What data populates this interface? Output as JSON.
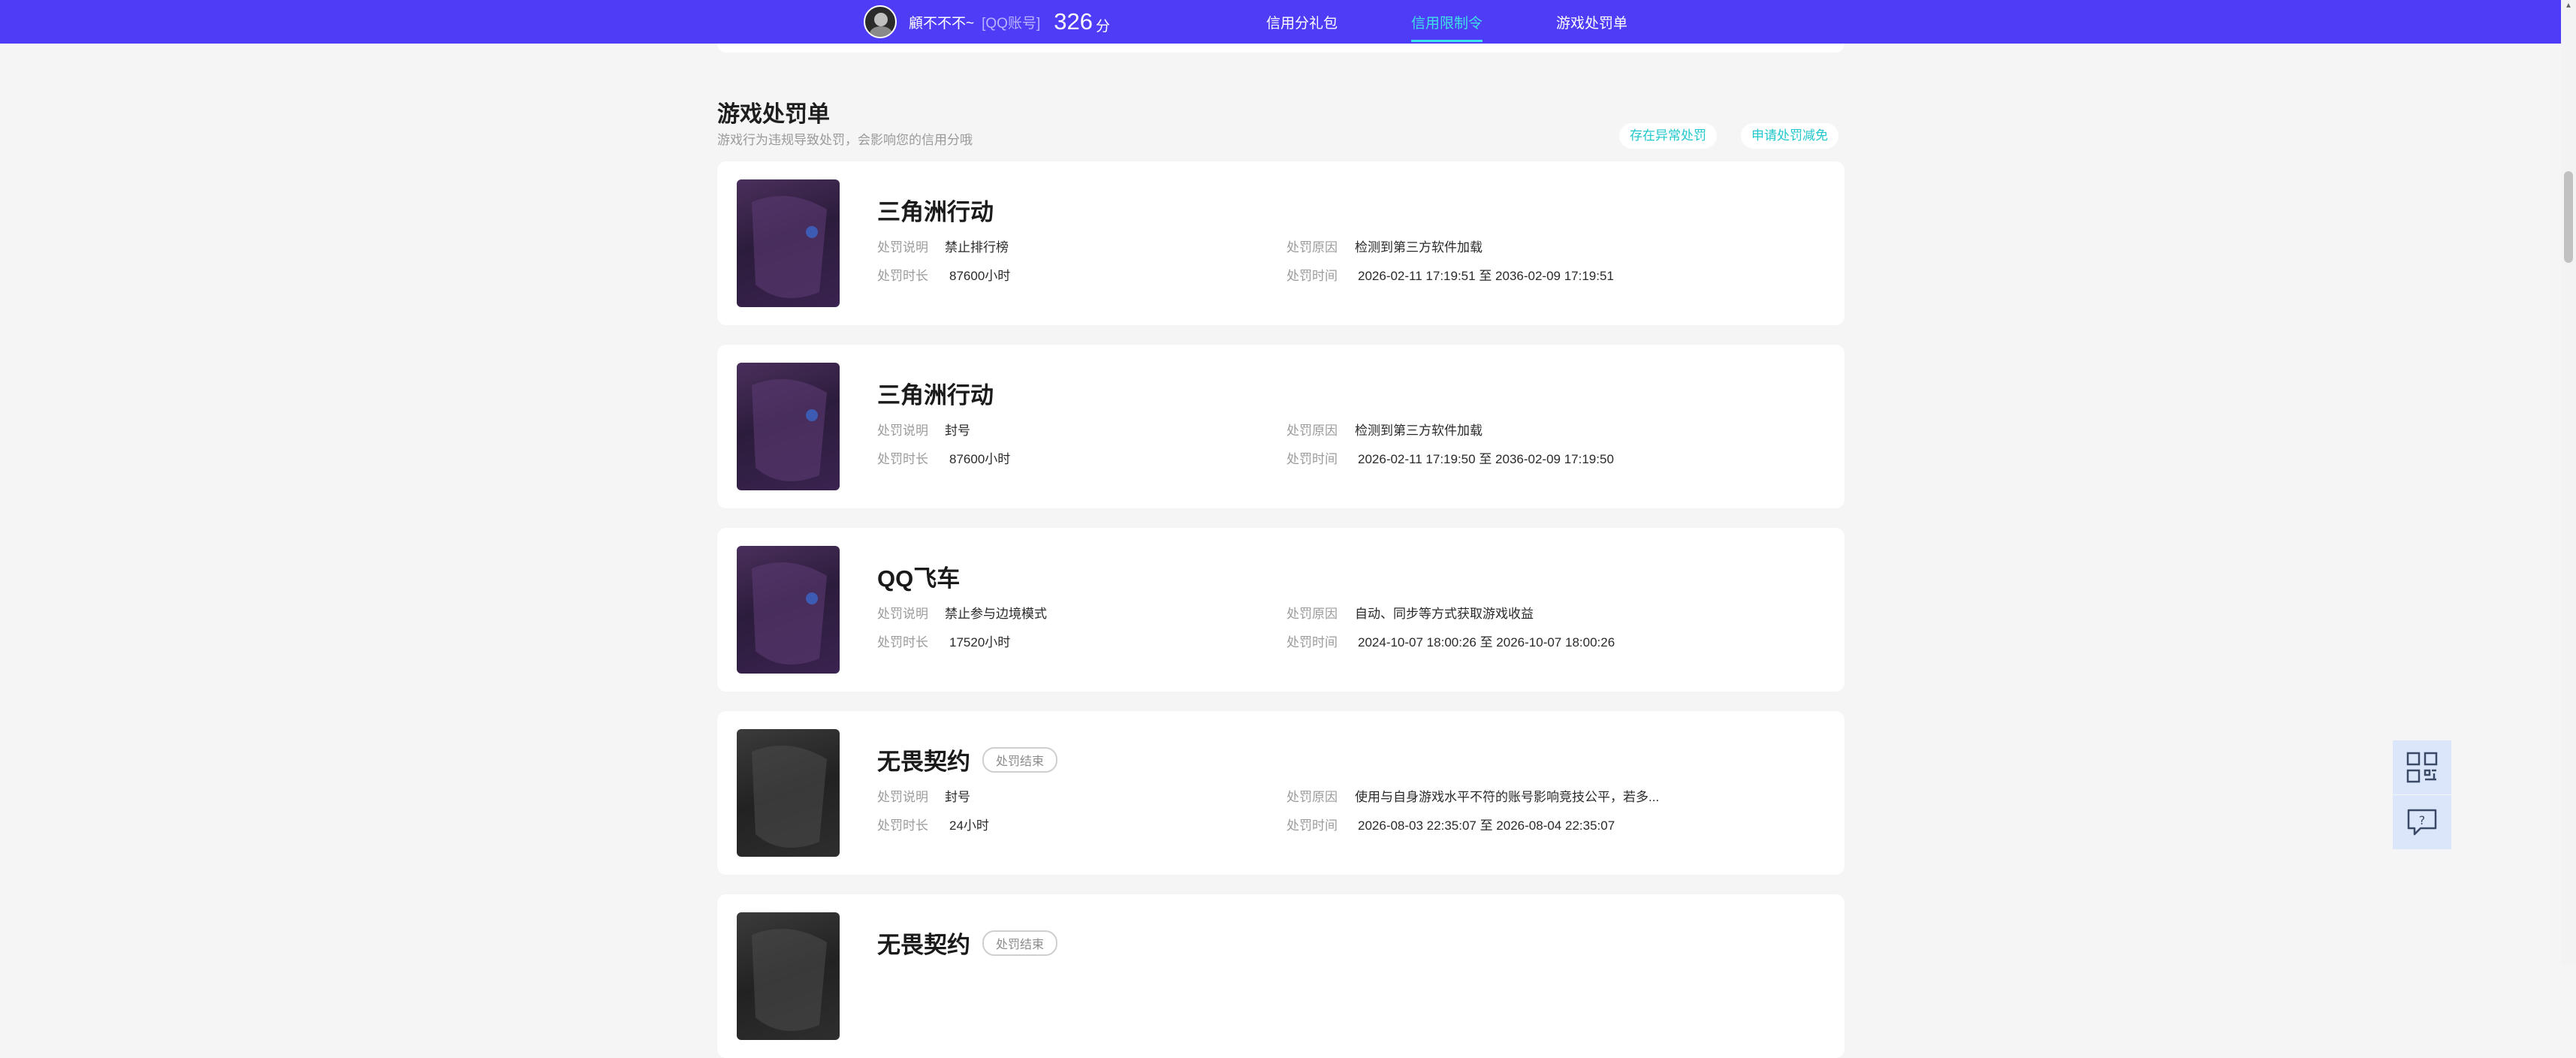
{
  "topbar": {
    "nickname": "顧不不不~",
    "account": "[QQ账号]",
    "score": "326",
    "score_unit": "分",
    "nav": [
      {
        "label": "信用分礼包",
        "active": false
      },
      {
        "label": "信用限制令",
        "active": true
      },
      {
        "label": "游戏处罚单",
        "active": false
      }
    ]
  },
  "section": {
    "title": "游戏处罚单",
    "subtitle": "游戏行为违规导致处罚，会影响您的信用分哦",
    "actions": [
      "存在异常处罚",
      "申请处罚减免"
    ]
  },
  "labels": {
    "desc": "处罚说明",
    "reason": "处罚原因",
    "duration": "处罚时长",
    "time": "处罚时间"
  },
  "cards": [
    {
      "game": "三角洲行动",
      "status": "",
      "desc": "禁止排行榜",
      "reason": "检测到第三方软件加载",
      "duration": "87600小时",
      "time": "2026-02-11 17:19:51 至 2036-02-09 17:19:51"
    },
    {
      "game": "三角洲行动",
      "status": "",
      "desc": "封号",
      "reason": "检测到第三方软件加载",
      "duration": "87600小时",
      "time": "2026-02-11 17:19:50 至 2036-02-09 17:19:50"
    },
    {
      "game": "QQ飞车",
      "status": "",
      "desc": "禁止参与边境模式",
      "reason": "自动、同步等方式获取游戏收益",
      "duration": "17520小时",
      "time": "2024-10-07 18:00:26 至 2026-10-07 18:00:26"
    },
    {
      "game": "无畏契约",
      "status": "处罚结束",
      "desc": "封号",
      "reason": "使用与自身游戏水平不符的账号影响竞技公平，若多...",
      "duration": "24小时",
      "time": "2026-08-03 22:35:07 至 2026-08-04 22:35:07"
    },
    {
      "game": "无畏契约",
      "status": "处罚结束"
    }
  ],
  "icons": {
    "qr": "qr-code-icon",
    "feedback": "feedback-icon"
  },
  "colors": {
    "topbar": "#4f3cf6",
    "accent": "#3de3e6",
    "pill_text": "#21c7cc"
  }
}
